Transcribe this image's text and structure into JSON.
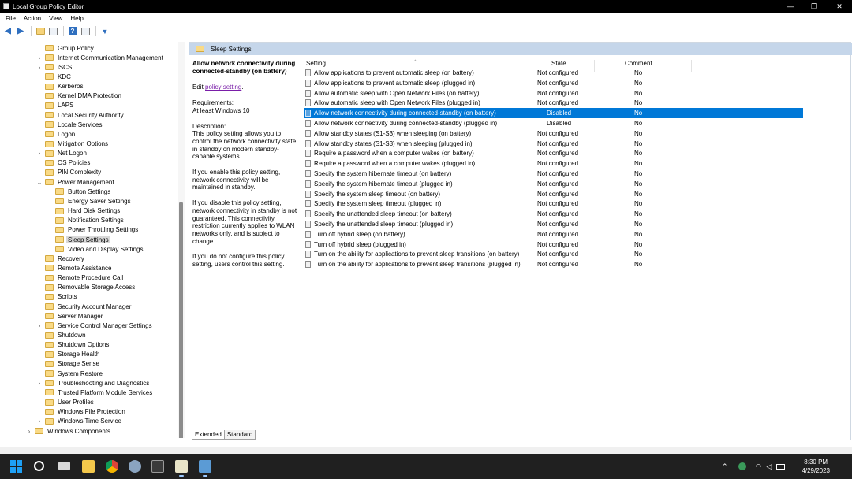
{
  "window": {
    "title": "Local Group Policy Editor",
    "minimize_glyph": "—",
    "restore_glyph": "❐",
    "close_glyph": "✕"
  },
  "menu": [
    "File",
    "Action",
    "View",
    "Help"
  ],
  "toolbar": {
    "icons": [
      "back-arrow-icon",
      "forward-arrow-icon",
      "up-folder-icon",
      "show-hide-tree-icon",
      "help-icon",
      "properties-icon",
      "filter-icon"
    ]
  },
  "tree": {
    "items": [
      {
        "label": "Group Policy",
        "level": 2,
        "expander": ""
      },
      {
        "label": "Internet Communication Management",
        "level": 2,
        "expander": "›"
      },
      {
        "label": "iSCSI",
        "level": 2,
        "expander": "›"
      },
      {
        "label": "KDC",
        "level": 2,
        "expander": ""
      },
      {
        "label": "Kerberos",
        "level": 2,
        "expander": ""
      },
      {
        "label": "Kernel DMA Protection",
        "level": 2,
        "expander": ""
      },
      {
        "label": "LAPS",
        "level": 2,
        "expander": ""
      },
      {
        "label": "Local Security Authority",
        "level": 2,
        "expander": ""
      },
      {
        "label": "Locale Services",
        "level": 2,
        "expander": ""
      },
      {
        "label": "Logon",
        "level": 2,
        "expander": ""
      },
      {
        "label": "Mitigation Options",
        "level": 2,
        "expander": ""
      },
      {
        "label": "Net Logon",
        "level": 2,
        "expander": "›"
      },
      {
        "label": "OS Policies",
        "level": 2,
        "expander": ""
      },
      {
        "label": "PIN Complexity",
        "level": 2,
        "expander": ""
      },
      {
        "label": "Power Management",
        "level": 2,
        "expander": "⌄"
      },
      {
        "label": "Button Settings",
        "level": 3,
        "expander": ""
      },
      {
        "label": "Energy Saver Settings",
        "level": 3,
        "expander": ""
      },
      {
        "label": "Hard Disk Settings",
        "level": 3,
        "expander": ""
      },
      {
        "label": "Notification Settings",
        "level": 3,
        "expander": ""
      },
      {
        "label": "Power Throttling Settings",
        "level": 3,
        "expander": ""
      },
      {
        "label": "Sleep Settings",
        "level": 3,
        "expander": "",
        "selected": true
      },
      {
        "label": "Video and Display Settings",
        "level": 3,
        "expander": ""
      },
      {
        "label": "Recovery",
        "level": 2,
        "expander": ""
      },
      {
        "label": "Remote Assistance",
        "level": 2,
        "expander": ""
      },
      {
        "label": "Remote Procedure Call",
        "level": 2,
        "expander": ""
      },
      {
        "label": "Removable Storage Access",
        "level": 2,
        "expander": ""
      },
      {
        "label": "Scripts",
        "level": 2,
        "expander": ""
      },
      {
        "label": "Security Account Manager",
        "level": 2,
        "expander": ""
      },
      {
        "label": "Server Manager",
        "level": 2,
        "expander": ""
      },
      {
        "label": "Service Control Manager Settings",
        "level": 2,
        "expander": "›"
      },
      {
        "label": "Shutdown",
        "level": 2,
        "expander": ""
      },
      {
        "label": "Shutdown Options",
        "level": 2,
        "expander": ""
      },
      {
        "label": "Storage Health",
        "level": 2,
        "expander": ""
      },
      {
        "label": "Storage Sense",
        "level": 2,
        "expander": ""
      },
      {
        "label": "System Restore",
        "level": 2,
        "expander": ""
      },
      {
        "label": "Troubleshooting and Diagnostics",
        "level": 2,
        "expander": "›"
      },
      {
        "label": "Trusted Platform Module Services",
        "level": 2,
        "expander": ""
      },
      {
        "label": "User Profiles",
        "level": 2,
        "expander": ""
      },
      {
        "label": "Windows File Protection",
        "level": 2,
        "expander": ""
      },
      {
        "label": "Windows Time Service",
        "level": 2,
        "expander": "›"
      },
      {
        "label": "Windows Components",
        "level": 1,
        "expander": "›"
      }
    ]
  },
  "header": {
    "title": "Sleep Settings"
  },
  "description": {
    "title": "Allow network connectivity during connected-standby (on battery)",
    "edit_prefix": "Edit ",
    "edit_link": "policy setting",
    "edit_suffix": ".",
    "requirements_label": "Requirements:",
    "requirements": "At least Windows 10",
    "description_label": "Description:",
    "description": "This policy setting allows you to control the network connectivity state in standby on modern standby-capable systems.",
    "enable": "If you enable this policy setting, network connectivity will be maintained in standby.",
    "disable": "If you disable this policy setting, network connectivity in standby is not guaranteed. This connectivity restriction currently applies to WLAN networks only, and is subject to change.",
    "not_configured": "If you do not configure this policy setting, users control this setting."
  },
  "columns": {
    "setting": "Setting",
    "state": "State",
    "comment": "Comment",
    "sort_glyph": "^"
  },
  "settings": [
    {
      "name": "Allow applications to prevent automatic sleep (on battery)",
      "state": "Not configured",
      "comment": "No"
    },
    {
      "name": "Allow applications to prevent automatic sleep (plugged in)",
      "state": "Not configured",
      "comment": "No"
    },
    {
      "name": "Allow automatic sleep with Open Network Files (on battery)",
      "state": "Not configured",
      "comment": "No"
    },
    {
      "name": "Allow automatic sleep with Open Network Files (plugged in)",
      "state": "Not configured",
      "comment": "No"
    },
    {
      "name": "Allow network connectivity during connected-standby (on battery)",
      "state": "Disabled",
      "comment": "No",
      "selected": true
    },
    {
      "name": "Allow network connectivity during connected-standby (plugged in)",
      "state": "Disabled",
      "comment": "No"
    },
    {
      "name": "Allow standby states (S1-S3) when sleeping (on battery)",
      "state": "Not configured",
      "comment": "No"
    },
    {
      "name": "Allow standby states (S1-S3) when sleeping (plugged in)",
      "state": "Not configured",
      "comment": "No"
    },
    {
      "name": "Require a password when a computer wakes (on battery)",
      "state": "Not configured",
      "comment": "No"
    },
    {
      "name": "Require a password when a computer wakes (plugged in)",
      "state": "Not configured",
      "comment": "No"
    },
    {
      "name": "Specify the system hibernate timeout (on battery)",
      "state": "Not configured",
      "comment": "No"
    },
    {
      "name": "Specify the system hibernate timeout (plugged in)",
      "state": "Not configured",
      "comment": "No"
    },
    {
      "name": "Specify the system sleep timeout (on battery)",
      "state": "Not configured",
      "comment": "No"
    },
    {
      "name": "Specify the system sleep timeout (plugged in)",
      "state": "Not configured",
      "comment": "No"
    },
    {
      "name": "Specify the unattended sleep timeout (on battery)",
      "state": "Not configured",
      "comment": "No"
    },
    {
      "name": "Specify the unattended sleep timeout (plugged in)",
      "state": "Not configured",
      "comment": "No"
    },
    {
      "name": "Turn off hybrid sleep (on battery)",
      "state": "Not configured",
      "comment": "No"
    },
    {
      "name": "Turn off hybrid sleep (plugged in)",
      "state": "Not configured",
      "comment": "No"
    },
    {
      "name": "Turn on the ability for applications to prevent sleep transitions (on battery)",
      "state": "Not configured",
      "comment": "No"
    },
    {
      "name": "Turn on the ability for applications to prevent sleep transitions (plugged in)",
      "state": "Not configured",
      "comment": "No"
    }
  ],
  "tabs": [
    "Extended",
    "Standard"
  ],
  "taskbar": {
    "apps": [
      "start-icon",
      "search-icon",
      "task-view-icon",
      "file-explorer-icon",
      "chrome-icon",
      "settings-icon",
      "terminal-icon",
      "notepad-icon",
      "group-policy-editor-icon"
    ],
    "tray_icons": [
      "chevron-up-icon",
      "network-status-icon",
      "wifi-icon",
      "volume-icon",
      "battery-icon"
    ],
    "time": "8:30 PM",
    "date": "4/29/2023"
  },
  "colors": {
    "selection": "#0078d7",
    "header_strip": "#c5d6ea",
    "taskbar": "#202020"
  }
}
